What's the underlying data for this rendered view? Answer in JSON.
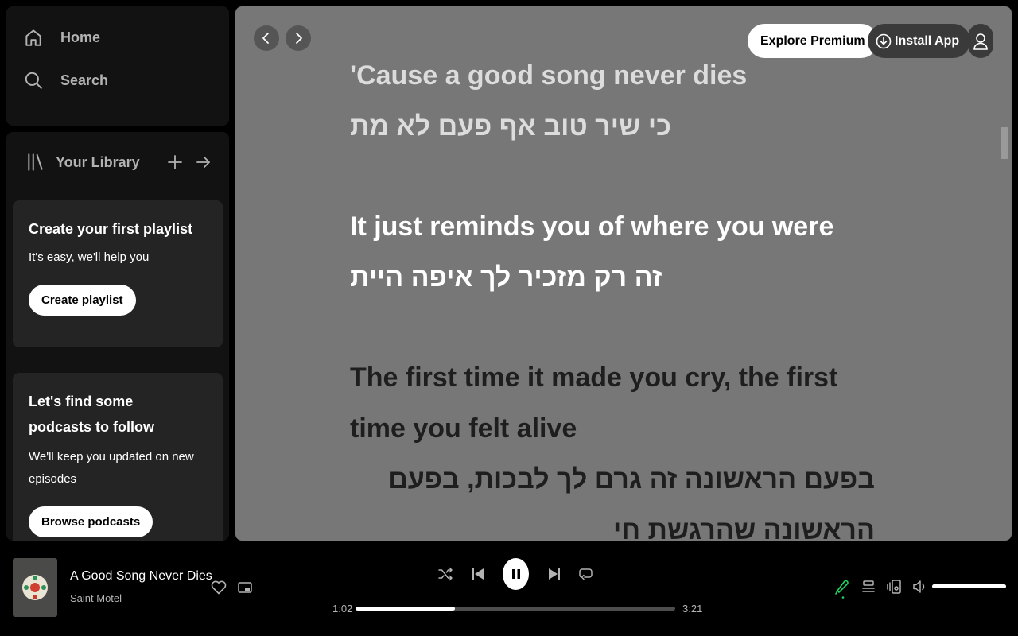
{
  "sidebar": {
    "nav": [
      {
        "label": "Home",
        "icon": "home-icon"
      },
      {
        "label": "Search",
        "icon": "search-icon"
      }
    ],
    "library": {
      "title": "Your Library",
      "cards": [
        {
          "title": "Create your first playlist",
          "subtitle": "It's easy, we'll help you",
          "button": "Create playlist"
        },
        {
          "title": "Let's find some podcasts to follow",
          "subtitle": "We'll keep you updated on new episodes",
          "button": "Browse podcasts"
        }
      ]
    }
  },
  "header": {
    "explore_premium": "Explore Premium",
    "install_app": "Install App"
  },
  "lyrics": {
    "lines": [
      {
        "text": "'Cause a good song never dies",
        "state": "past",
        "dir": "ltr"
      },
      {
        "text": "כי שיר טוב אף פעם לא מת",
        "state": "past",
        "dir": "rtl"
      },
      {
        "text": "It just reminds you of where you were",
        "state": "current",
        "dir": "ltr"
      },
      {
        "text": "זה רק מזכיר לך איפה היית",
        "state": "current",
        "dir": "rtl"
      },
      {
        "text": "The first time it made you cry, the first time you felt alive",
        "state": "upcoming",
        "dir": "ltr"
      },
      {
        "text": "בפעם הראשונה זה גרם לך לבכות, בפעם הראשונה שהרגשת חי",
        "state": "upcoming",
        "dir": "rtl"
      }
    ]
  },
  "player": {
    "track_title": "A Good Song Never Dies",
    "artist": "Saint Motel",
    "elapsed": "1:02",
    "duration": "3:21",
    "progress_fraction": 0.31,
    "volume_fraction": 1.0,
    "accent_color": "#1ed760"
  }
}
